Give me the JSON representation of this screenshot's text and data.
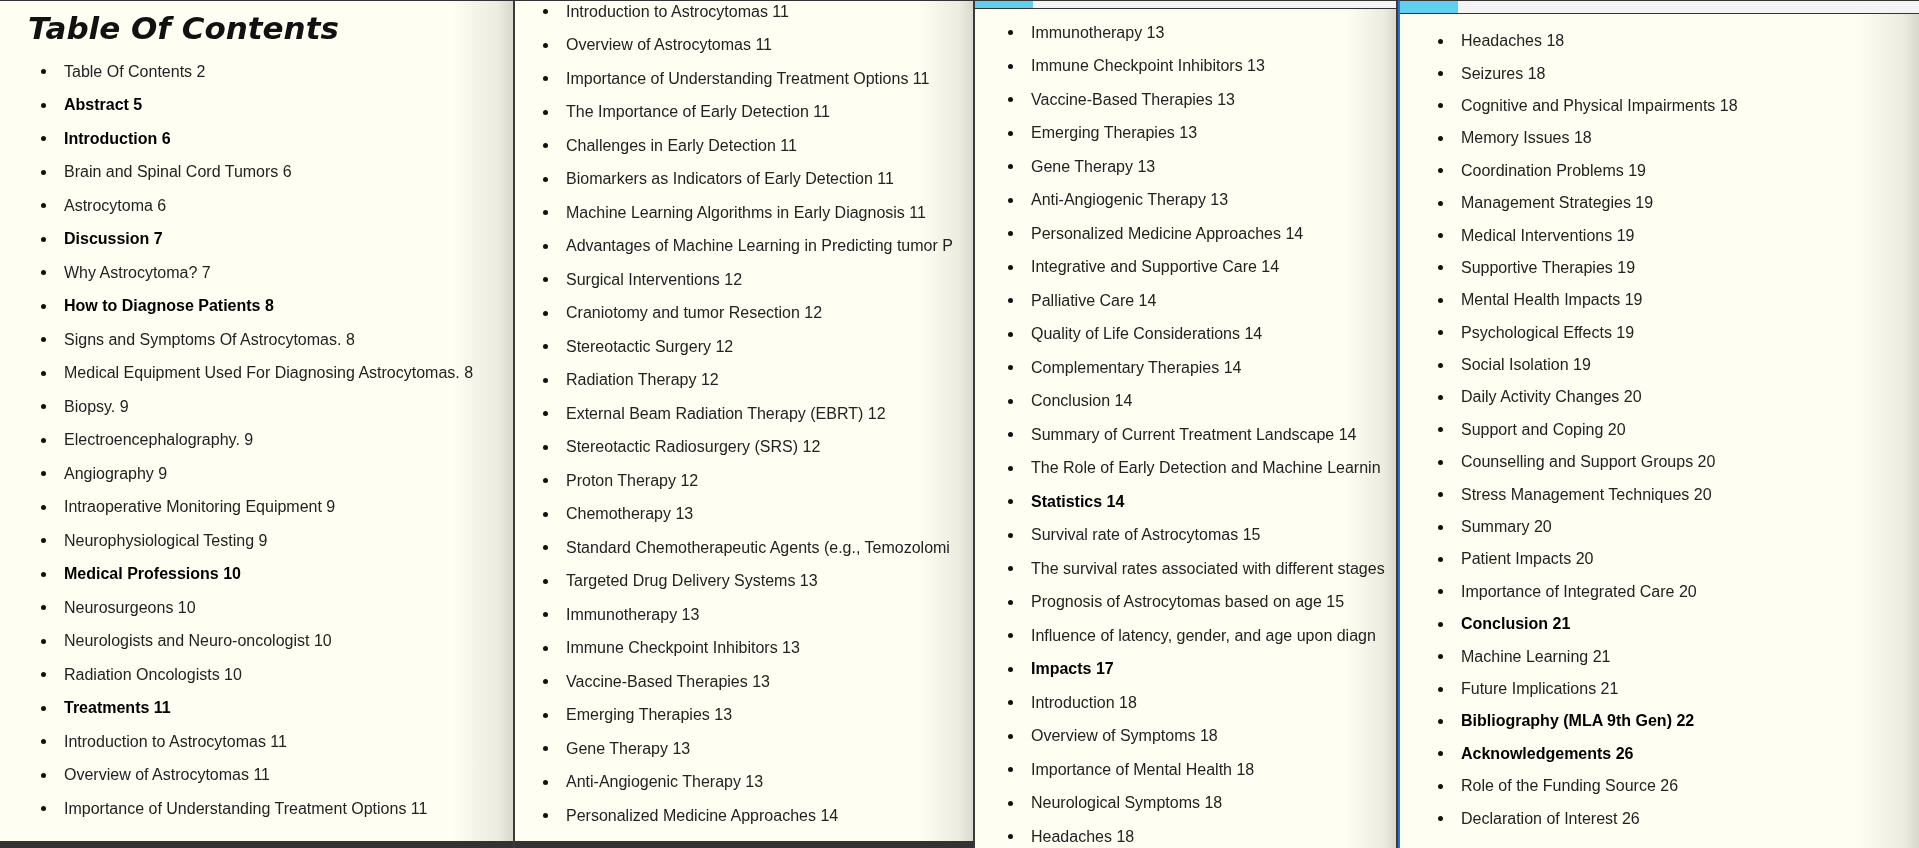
{
  "panels": [
    {
      "kind": "plain",
      "title": "Table Of Contents",
      "items": [
        {
          "text": "Table Of Contents 2",
          "kind": "entry"
        },
        {
          "text": "Abstract 5",
          "kind": "section"
        },
        {
          "text": "Introduction 6",
          "kind": "section"
        },
        {
          "text": "Brain and Spinal Cord Tumors 6",
          "kind": "entry"
        },
        {
          "text": "Astrocytoma 6",
          "kind": "entry"
        },
        {
          "text": "Discussion 7",
          "kind": "section"
        },
        {
          "text": "Why Astrocytoma? 7",
          "kind": "entry"
        },
        {
          "text": "How to Diagnose Patients 8",
          "kind": "section"
        },
        {
          "text": "Signs and Symptoms Of Astrocytomas. 8",
          "kind": "entry"
        },
        {
          "text": "Medical Equipment Used For Diagnosing Astrocytomas. 8",
          "kind": "entry"
        },
        {
          "text": "Biopsy. 9",
          "kind": "entry"
        },
        {
          "text": "Electroencephalography. 9",
          "kind": "entry"
        },
        {
          "text": "Angiography 9",
          "kind": "entry"
        },
        {
          "text": "Intraoperative Monitoring Equipment 9",
          "kind": "entry"
        },
        {
          "text": "Neurophysiological Testing 9",
          "kind": "entry"
        },
        {
          "text": "Medical Professions 10",
          "kind": "section"
        },
        {
          "text": "Neurosurgeons 10",
          "kind": "entry"
        },
        {
          "text": "Neurologists and Neuro-oncologist 10",
          "kind": "entry"
        },
        {
          "text": "Radiation Oncologists 10",
          "kind": "entry"
        },
        {
          "text": "Treatments 11",
          "kind": "section"
        },
        {
          "text": "Introduction to Astrocytomas 11",
          "kind": "entry"
        },
        {
          "text": "Overview of Astrocytomas 11",
          "kind": "entry"
        },
        {
          "text": "Importance of Understanding Treatment Options 11",
          "kind": "entry"
        }
      ]
    },
    {
      "kind": "plain",
      "items": [
        {
          "text": "Introduction to Astrocytomas 11",
          "kind": "entry"
        },
        {
          "text": "Overview of Astrocytomas 11",
          "kind": "entry"
        },
        {
          "text": "Importance of Understanding Treatment Options 11",
          "kind": "entry"
        },
        {
          "text": "The Importance of Early Detection 11",
          "kind": "entry"
        },
        {
          "text": "Challenges in Early Detection 11",
          "kind": "entry"
        },
        {
          "text": "Biomarkers as Indicators of Early Detection 11",
          "kind": "entry"
        },
        {
          "text": "Machine Learning Algorithms in Early Diagnosis 11",
          "kind": "entry"
        },
        {
          "text": "Advantages of Machine Learning in Predicting tumor P",
          "kind": "entry"
        },
        {
          "text": "Surgical Interventions 12",
          "kind": "entry"
        },
        {
          "text": "Craniotomy and tumor Resection 12",
          "kind": "entry"
        },
        {
          "text": "Stereotactic Surgery 12",
          "kind": "entry"
        },
        {
          "text": "Radiation Therapy 12",
          "kind": "entry"
        },
        {
          "text": "External Beam Radiation Therapy (EBRT) 12",
          "kind": "entry"
        },
        {
          "text": "Stereotactic Radiosurgery (SRS) 12",
          "kind": "entry"
        },
        {
          "text": "Proton Therapy 12",
          "kind": "entry"
        },
        {
          "text": "Chemotherapy 13",
          "kind": "entry"
        },
        {
          "text": "Standard Chemotherapeutic Agents (e.g., Temozolomi",
          "kind": "entry"
        },
        {
          "text": "Targeted Drug Delivery Systems 13",
          "kind": "entry"
        },
        {
          "text": "Immunotherapy 13",
          "kind": "entry"
        },
        {
          "text": "Immune Checkpoint Inhibitors 13",
          "kind": "entry"
        },
        {
          "text": "Vaccine-Based Therapies 13",
          "kind": "entry"
        },
        {
          "text": "Emerging Therapies 13",
          "kind": "entry"
        },
        {
          "text": "Gene Therapy 13",
          "kind": "entry"
        },
        {
          "text": "Anti-Angiogenic Therapy 13",
          "kind": "entry"
        },
        {
          "text": "Personalized Medicine Approaches 14",
          "kind": "entry"
        }
      ]
    },
    {
      "kind": "tabbed",
      "items": [
        {
          "text": "Immunotherapy 13",
          "kind": "entry"
        },
        {
          "text": "Immune Checkpoint Inhibitors 13",
          "kind": "entry"
        },
        {
          "text": "Vaccine-Based Therapies 13",
          "kind": "entry"
        },
        {
          "text": "Emerging Therapies 13",
          "kind": "entry"
        },
        {
          "text": "Gene Therapy 13",
          "kind": "entry"
        },
        {
          "text": "Anti-Angiogenic Therapy 13",
          "kind": "entry"
        },
        {
          "text": "Personalized Medicine Approaches 14",
          "kind": "entry"
        },
        {
          "text": "Integrative and Supportive Care 14",
          "kind": "entry"
        },
        {
          "text": "Palliative Care 14",
          "kind": "entry"
        },
        {
          "text": "Quality of Life Considerations 14",
          "kind": "entry"
        },
        {
          "text": "Complementary Therapies 14",
          "kind": "entry"
        },
        {
          "text": "Conclusion 14",
          "kind": "entry"
        },
        {
          "text": "Summary of Current Treatment Landscape 14",
          "kind": "entry"
        },
        {
          "text": "The Role of Early Detection and Machine Learnin",
          "kind": "entry"
        },
        {
          "text": "Statistics 14",
          "kind": "section"
        },
        {
          "text": "Survival rate of Astrocytomas 15",
          "kind": "entry"
        },
        {
          "text": "The survival rates associated with different stages",
          "kind": "entry"
        },
        {
          "text": "Prognosis of Astrocytomas based on age 15",
          "kind": "entry"
        },
        {
          "text": "Influence of latency, gender, and age upon diagn",
          "kind": "entry"
        },
        {
          "text": "Impacts 17",
          "kind": "section"
        },
        {
          "text": "Introduction 18",
          "kind": "entry"
        },
        {
          "text": "Overview of Symptoms 18",
          "kind": "entry"
        },
        {
          "text": "Importance of Mental Health 18",
          "kind": "entry"
        },
        {
          "text": "Neurological Symptoms 18",
          "kind": "entry"
        },
        {
          "text": "Headaches 18",
          "kind": "entry"
        }
      ]
    },
    {
      "kind": "tabbed",
      "items": [
        {
          "text": "Headaches 18",
          "kind": "entry"
        },
        {
          "text": "Seizures 18",
          "kind": "entry"
        },
        {
          "text": "Cognitive and Physical Impairments 18",
          "kind": "entry"
        },
        {
          "text": "Memory Issues 18",
          "kind": "entry"
        },
        {
          "text": "Coordination Problems 19",
          "kind": "entry"
        },
        {
          "text": "Management Strategies 19",
          "kind": "entry"
        },
        {
          "text": "Medical Interventions 19",
          "kind": "entry"
        },
        {
          "text": "Supportive Therapies 19",
          "kind": "entry"
        },
        {
          "text": "Mental Health Impacts 19",
          "kind": "entry"
        },
        {
          "text": "Psychological Effects 19",
          "kind": "entry"
        },
        {
          "text": "Social Isolation 19",
          "kind": "entry"
        },
        {
          "text": "Daily Activity Changes 20",
          "kind": "entry"
        },
        {
          "text": "Support and Coping 20",
          "kind": "entry"
        },
        {
          "text": "Counselling and Support Groups 20",
          "kind": "entry"
        },
        {
          "text": "Stress Management Techniques 20",
          "kind": "entry"
        },
        {
          "text": "Summary 20",
          "kind": "entry"
        },
        {
          "text": "Patient Impacts 20",
          "kind": "entry"
        },
        {
          "text": "Importance of Integrated Care 20",
          "kind": "entry"
        },
        {
          "text": "Conclusion 21",
          "kind": "section"
        },
        {
          "text": "Machine Learning 21",
          "kind": "entry"
        },
        {
          "text": "Future Implications 21",
          "kind": "entry"
        },
        {
          "text": "Bibliography (MLA 9th Gen) 22",
          "kind": "section"
        },
        {
          "text": "Acknowledgements 26",
          "kind": "section"
        },
        {
          "text": "Role of the Funding Source 26",
          "kind": "entry"
        },
        {
          "text": "Declaration of Interest 26",
          "kind": "entry"
        }
      ]
    }
  ]
}
